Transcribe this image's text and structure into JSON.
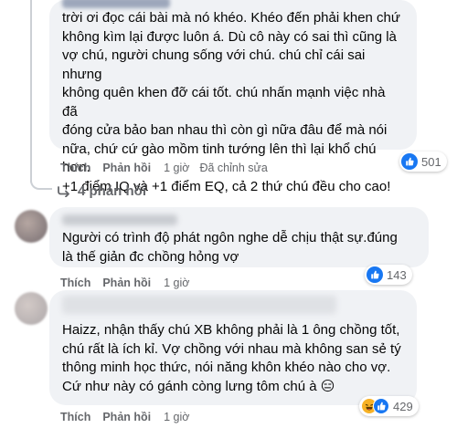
{
  "comments": [
    {
      "text": "trời ơi đọc cái bài mà nó khéo. Khéo đến phải khen chứ\nkhông kìm lại được luôn á. Dù cô này có sai thì cũng là\nvợ chú, người chung sống với chú. chú chỉ cái sai nhưng\nkhông quên khen đỡ cái tốt. chú nhấn mạnh việc nhà đã\nđóng cửa bảo ban nhau thì còn gì nữa đâu để mà nói\nnữa, chứ cứ gào mồm tinh tướng lên thì lại khổ chú hơn.\n+1 điểm IQ và +1 điểm EQ, cả 2 thứ chú đều cho cao!",
      "like_label": "Thích",
      "reply_label": "Phản hồi",
      "time": "1 giờ",
      "edited": "Đã chỉnh sửa",
      "reaction_count": "501",
      "replies_label": "4 phản hồi"
    },
    {
      "text": "Người có trình độ phát ngôn nghe dễ chịu thật sự.đúng\nlà thế giản đc chồng hỏng vợ",
      "like_label": "Thích",
      "reply_label": "Phản hồi",
      "time": "1 giờ",
      "reaction_count": "143"
    },
    {
      "text": "Haizz, nhận thấy chú XB không phải là 1 ông chồng tốt,\nchú rất là ích kỉ. Vợ chồng với nhau mà không san sẻ tý\nthông minh học thức, nói năng khôn khéo nào cho vợ.\nCứ như này có gánh còng lưng tôm chú à 😑",
      "like_label": "Thích",
      "reply_label": "Phản hồi",
      "time": "1 giờ",
      "reaction_count": "429"
    }
  ],
  "icons": {
    "like": "like-reaction-icon",
    "haha": "haha-reaction-icon",
    "reply_arrow": "reply-arrow-icon"
  },
  "colors": {
    "bubble": "#f0f2f5",
    "like_blue": "#1877f2",
    "haha_yellow": "#f7b125",
    "muted_text": "#65676b"
  }
}
